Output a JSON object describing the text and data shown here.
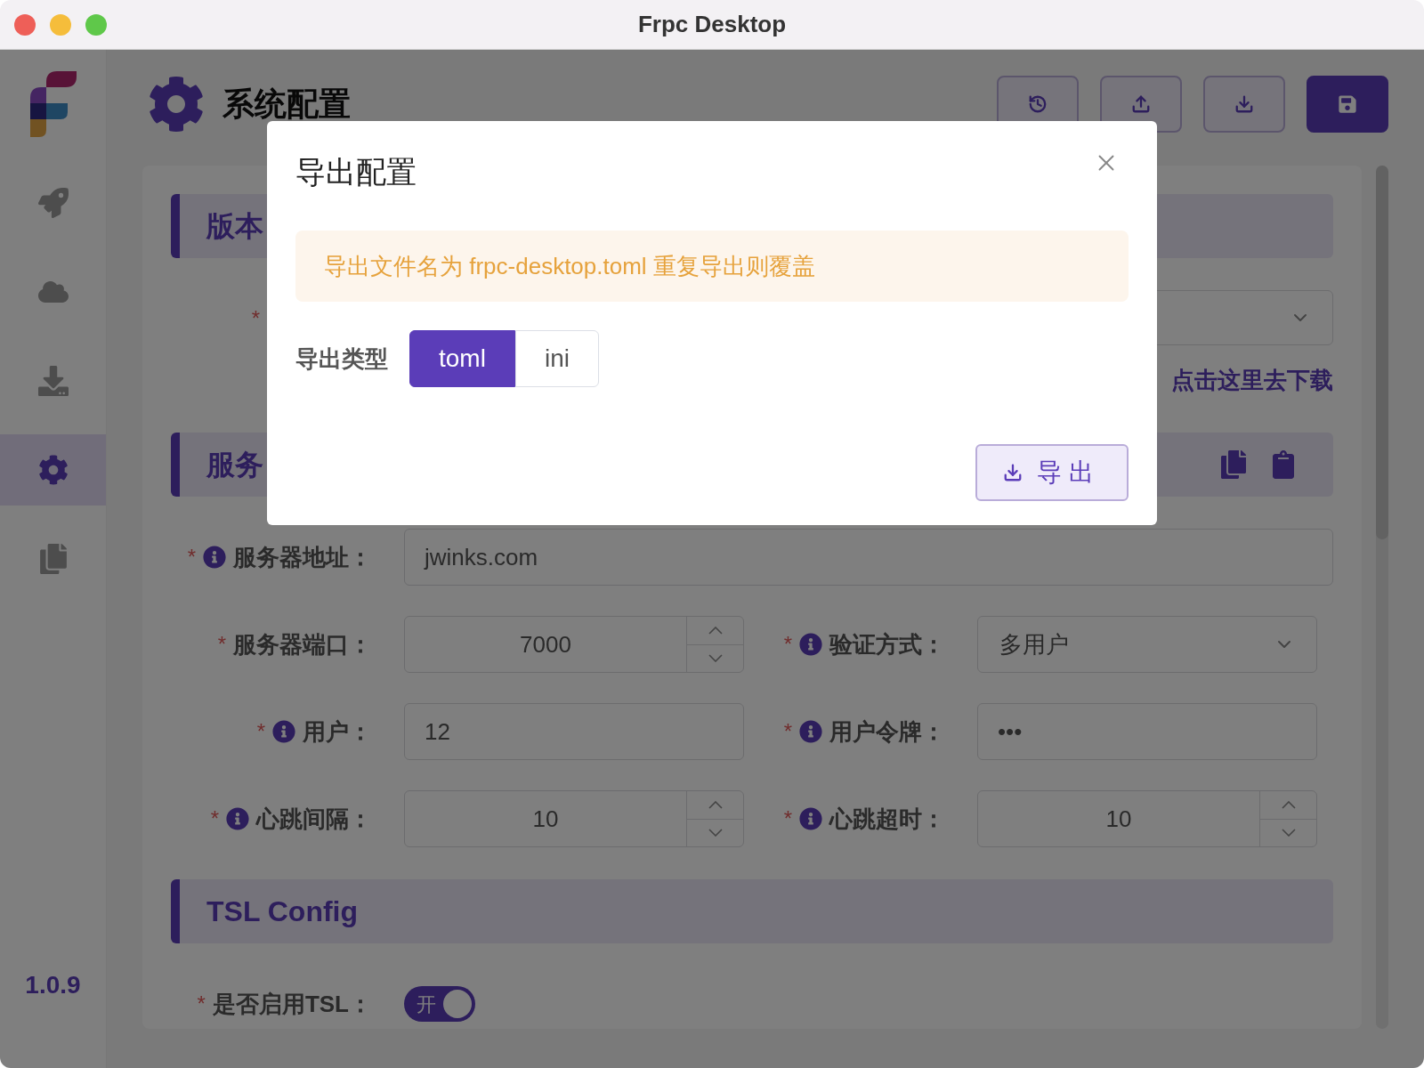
{
  "window": {
    "title": "Frpc Desktop"
  },
  "sidebar": {
    "items": [
      {
        "kind": "rocket",
        "selected": false
      },
      {
        "kind": "cloud",
        "selected": false
      },
      {
        "kind": "download",
        "selected": false
      },
      {
        "kind": "gear",
        "selected": true
      },
      {
        "kind": "files",
        "selected": false
      }
    ],
    "version": "1.0.9"
  },
  "header": {
    "title": "系统配置",
    "toolbar": [
      {
        "kind": "history",
        "primary": false
      },
      {
        "kind": "upload",
        "primary": false
      },
      {
        "kind": "download",
        "primary": false
      },
      {
        "kind": "save",
        "primary": true
      }
    ]
  },
  "version_section": {
    "title": "版本",
    "required_mark": "*",
    "link": "点击这里去下载"
  },
  "server_section": {
    "title": "服务",
    "rows": [
      [
        {
          "label": "服务器地址：",
          "required_mark": "*",
          "info": true,
          "kind": "text",
          "value": "jwinks.com"
        }
      ],
      [
        {
          "label": "服务器端口：",
          "required_mark": "*",
          "info": false,
          "kind": "number",
          "value": "7000"
        },
        {
          "label": "验证方式：",
          "required_mark": "*",
          "info": true,
          "kind": "select",
          "value": "多用户"
        }
      ],
      [
        {
          "label": "用户：",
          "required_mark": "*",
          "info": true,
          "kind": "text",
          "value": "12"
        },
        {
          "label": "用户令牌：",
          "required_mark": "*",
          "info": true,
          "kind": "text",
          "value": "•••"
        }
      ],
      [
        {
          "label": "心跳间隔：",
          "required_mark": "*",
          "info": true,
          "kind": "number",
          "value": "10"
        },
        {
          "label": "心跳超时：",
          "required_mark": "*",
          "info": true,
          "kind": "number",
          "value": "10"
        }
      ]
    ]
  },
  "tsl_section": {
    "title": "TSL Config",
    "field": {
      "label": "是否启用TSL：",
      "required_mark": "*",
      "on": true,
      "on_text": "开"
    }
  },
  "dialog": {
    "title": "导出配置",
    "notice": "导出文件名为 frpc-desktop.toml 重复导出则覆盖",
    "type_label": "导出类型",
    "options": [
      {
        "label": "toml",
        "selected": true
      },
      {
        "label": "ini",
        "selected": false
      }
    ],
    "export_button": "导出"
  }
}
